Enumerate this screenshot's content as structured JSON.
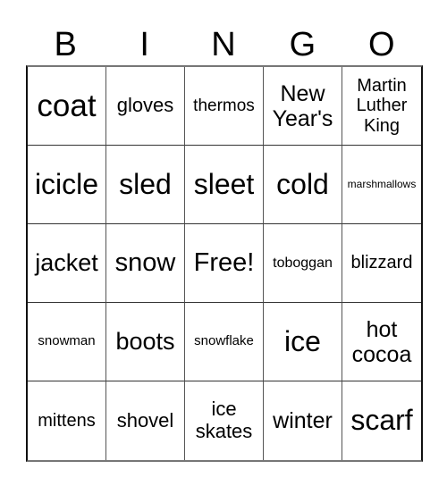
{
  "header": [
    "B",
    "I",
    "N",
    "G",
    "O"
  ],
  "cells": [
    [
      "coat",
      "gloves",
      "thermos",
      "New Year's",
      "Martin Luther King"
    ],
    [
      "icicle",
      "sled",
      "sleet",
      "cold",
      "marshmallows"
    ],
    [
      "jacket",
      "snow",
      "Free!",
      "toboggan",
      "blizzard"
    ],
    [
      "snowman",
      "boots",
      "snowflake",
      "ice",
      "hot cocoa"
    ],
    [
      "mittens",
      "shovel",
      "ice skates",
      "winter",
      "scarf"
    ]
  ]
}
